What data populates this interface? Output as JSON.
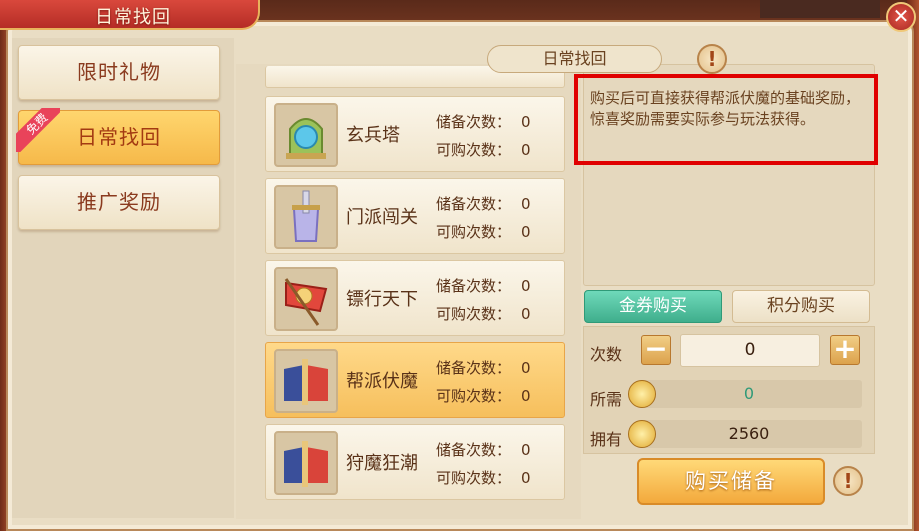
{
  "window": {
    "title": "日常找回",
    "close_label": "✕"
  },
  "sidebar": {
    "tabs": [
      {
        "label": "限时礼物",
        "active": false
      },
      {
        "label": "日常找回",
        "active": true,
        "badge": "免费"
      },
      {
        "label": "推广奖励",
        "active": false
      }
    ]
  },
  "activity_list": {
    "items": [
      {
        "name": "玄兵塔",
        "icon": "tower-icon",
        "stored_label": "储备次数：",
        "stored": "0",
        "buyable_label": "可购次数：",
        "buyable": "0",
        "selected": false
      },
      {
        "name": "门派闯关",
        "icon": "sword-icon",
        "stored_label": "储备次数：",
        "stored": "0",
        "buyable_label": "可购次数：",
        "buyable": "0",
        "selected": false
      },
      {
        "name": "镖行天下",
        "icon": "banner-icon",
        "stored_label": "储备次数：",
        "stored": "0",
        "buyable_label": "可购次数：",
        "buyable": "0",
        "selected": false
      },
      {
        "name": "帮派伏魔",
        "icon": "flags-icon",
        "stored_label": "储备次数：",
        "stored": "0",
        "buyable_label": "可购次数：",
        "buyable": "0",
        "selected": true
      },
      {
        "name": "狩魔狂潮",
        "icon": "flags-icon",
        "stored_label": "储备次数：",
        "stored": "0",
        "buyable_label": "可购次数：",
        "buyable": "0",
        "selected": false
      }
    ]
  },
  "detail": {
    "header": "日常找回",
    "help_symbol": "!",
    "description": "购买后可直接获得帮派伏魔的基础奖励，惊喜奖励需要实际参与玩法获得。"
  },
  "purchase": {
    "tab_gold": "金券购买",
    "tab_points": "积分购买",
    "qty_label": "次数",
    "qty_value": "0",
    "minus": "−",
    "plus": "+",
    "cost_label": "所需",
    "cost_value": "0",
    "own_label": "拥有",
    "own_value": "2560",
    "confirm_label": "购买储备",
    "confirm_help": "!"
  },
  "colors": {
    "accent_green": "#3fae8c",
    "accent_gold": "#f3a93c",
    "highlight_red": "#e00000",
    "cost_text": "#2f9a78"
  }
}
